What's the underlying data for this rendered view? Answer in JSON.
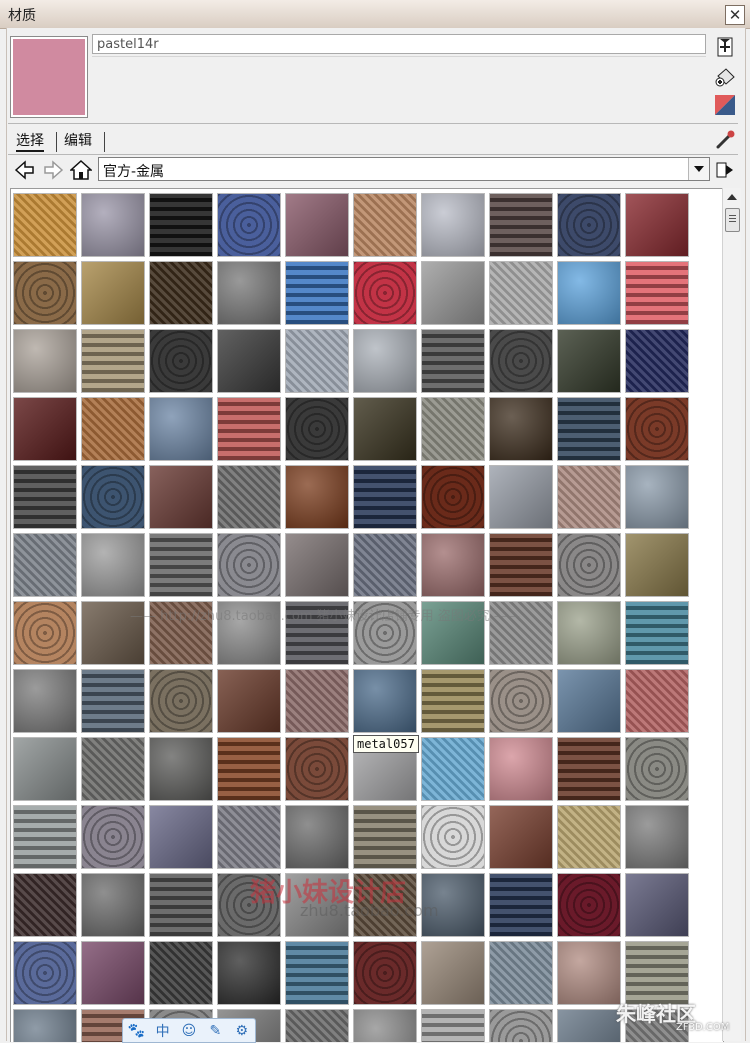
{
  "window": {
    "title": "材质",
    "close_glyph": "✕"
  },
  "material": {
    "name": "pastel14r",
    "swatch_color": "#d08aa0"
  },
  "tabs": [
    {
      "label": "选择"
    },
    {
      "label": "编辑"
    }
  ],
  "library": {
    "selected": "官方-金属"
  },
  "tooltip": "metal057",
  "watermarks": {
    "center_line": "—— http://zhu8.taobao.com 猪小妹设计店铺专用  盗图必究 ——",
    "logo_text": "猪小妹设计店",
    "logo_url": "zhu8.taobao.com",
    "corner_brand": "朱峰社区",
    "corner_url": "ZF3D.COM"
  },
  "bottom_toolbar": [
    "paw-icon",
    "中",
    "smile-icon",
    "pencil-icon",
    "gear-icon"
  ],
  "materials": [
    [
      "#c98f3a",
      "#9a95a8",
      "#1a1a1a",
      "#4a5f9c",
      "#8a5a6a",
      "#b78560",
      "#b9bcc7",
      "#5a4a48",
      "#3d4a6a",
      "#8a2a30"
    ],
    [
      "#8a6a48",
      "#a88a4a",
      "#3a2a1a",
      "#777777",
      "#3d78c2",
      "#c23346",
      "#9a9a9a",
      "#a8a8a8",
      "#5aa2dd",
      "#e06068"
    ],
    [
      "#aaa198",
      "#a89a7a",
      "#3a3a3a",
      "#3a3a3a",
      "#a0a8b4",
      "#aab0b8",
      "#5a5a5a",
      "#4a4a4a",
      "#333a2a",
      "#22285a"
    ],
    [
      "#5a1a1a",
      "#a66a3a",
      "#6a84a4",
      "#c05a58",
      "#3a3a3a",
      "#3a3420",
      "#8a8a80",
      "#3a2a1a",
      "#34485e",
      "#7a3a28"
    ],
    [
      "#4a4a4a",
      "#3d5470",
      "#6a3a34",
      "#6a6a6a",
      "#7a3a1a",
      "#2a3a5a",
      "#6a2a1a",
      "#9aa0aa",
      "#aa8a80",
      "#8a9aaa"
    ],
    [
      "#7a8088",
      "#9a9a9a",
      "#6a6a6a",
      "#8a8a90",
      "#7a7070",
      "#6a7080",
      "#9a6a6a",
      "#6a3a2a",
      "#8a8888",
      "#8a7a4a"
    ],
    [
      "#b48460",
      "#6a5a4a",
      "#7a5a4a",
      "#8a8a8a",
      "#5a5a60",
      "#9a9a9a",
      "#5a8a7a",
      "#8a8a8a",
      "#9aa08a",
      "#4a8aa0"
    ],
    [
      "#7a7a7a",
      "#5a6a7a",
      "#7a7060",
      "#6a3a2a",
      "#8a6a68",
      "#4a6a8a",
      "#9a8a5a",
      "#9a9088",
      "#5a7a9a",
      "#b06060"
    ],
    [
      "#8a9090",
      "#6a6a68",
      "#5a5a58",
      "#8a4a2a",
      "#7a4a3a",
      "#a8a8aa",
      "#66a8d0",
      "#d08890",
      "#6a3a2a",
      "#8a8a84"
    ],
    [
      "#9aa0a0",
      "#8a8490",
      "#6a6a8a",
      "#7a7a84",
      "#6a6a6a",
      "#8a8270",
      "#d8d8d8",
      "#7a4030",
      "#b8a470",
      "#7a7a7a"
    ],
    [
      "#3a2a2a",
      "#6a6a6a",
      "#5a5a5a",
      "#6a6a6a",
      "#8a8a8a",
      "#5a4a3a",
      "#4a5a6a",
      "#2a3a5a",
      "#6a1a2a",
      "#5a5a78"
    ],
    [
      "#5a6a9a",
      "#7a4a6a",
      "#3a3a3a",
      "#2a2a2a",
      "#4a7a9a",
      "#6a2a2a",
      "#9a8a7a",
      "#7a8a98",
      "#b08a80",
      "#9a9a88"
    ],
    [
      "#6a7a8a",
      "#9a6a5a",
      "#8a8a8a",
      "#7a7a7a",
      "#6a6a6a",
      "#8a8a8a",
      "#aaaaaa",
      "#9a9a9a",
      "#6a7a8a",
      "#7a7a7a"
    ]
  ]
}
